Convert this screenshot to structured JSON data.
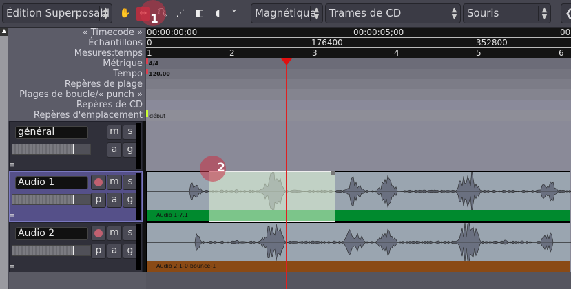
{
  "toolbar": {
    "edit_mode": "Édition Superposabl",
    "snap": "Magnétique",
    "grid": "Trames de CD",
    "edit_point": "Souris",
    "tools": [
      "grab-icon",
      "range-icon",
      "zoom-icon",
      "draw-icon",
      "audition-icon",
      "stretch-icon"
    ]
  },
  "rulers": {
    "labels": [
      "« Timecode »",
      "Échantillons",
      "Mesures:temps",
      "Métrique",
      "Tempo",
      "Repères de plage",
      "Plages de boucle/« punch »",
      "Repères de CD",
      "Repères d'emplacement"
    ],
    "timecode": [
      "00:00:00;00",
      "00:00:05;00",
      "00"
    ],
    "samples": [
      "0",
      "176400",
      "352800"
    ],
    "bars": [
      "1",
      "2",
      "3",
      "4",
      "5",
      "6"
    ],
    "meter": "4/4",
    "tempo": "120,00",
    "location_marker": "début"
  },
  "tracks": [
    {
      "name": "général",
      "buttons": [
        "m",
        "s",
        "a",
        "g"
      ]
    },
    {
      "name": "Audio 1",
      "buttons": [
        "m",
        "s",
        "p",
        "a",
        "g"
      ],
      "region": "Audio 1-7.1",
      "region_color": "#008a2e",
      "selected": true
    },
    {
      "name": "Audio 2",
      "buttons": [
        "m",
        "s",
        "p",
        "a",
        "g"
      ],
      "region": "Audio 2.1-0-bounce-1",
      "region_color": "#8a4a15"
    }
  ],
  "badges": [
    "1",
    "2"
  ],
  "colors": {
    "playhead": "#e02020",
    "selection": "#d8efd0"
  }
}
